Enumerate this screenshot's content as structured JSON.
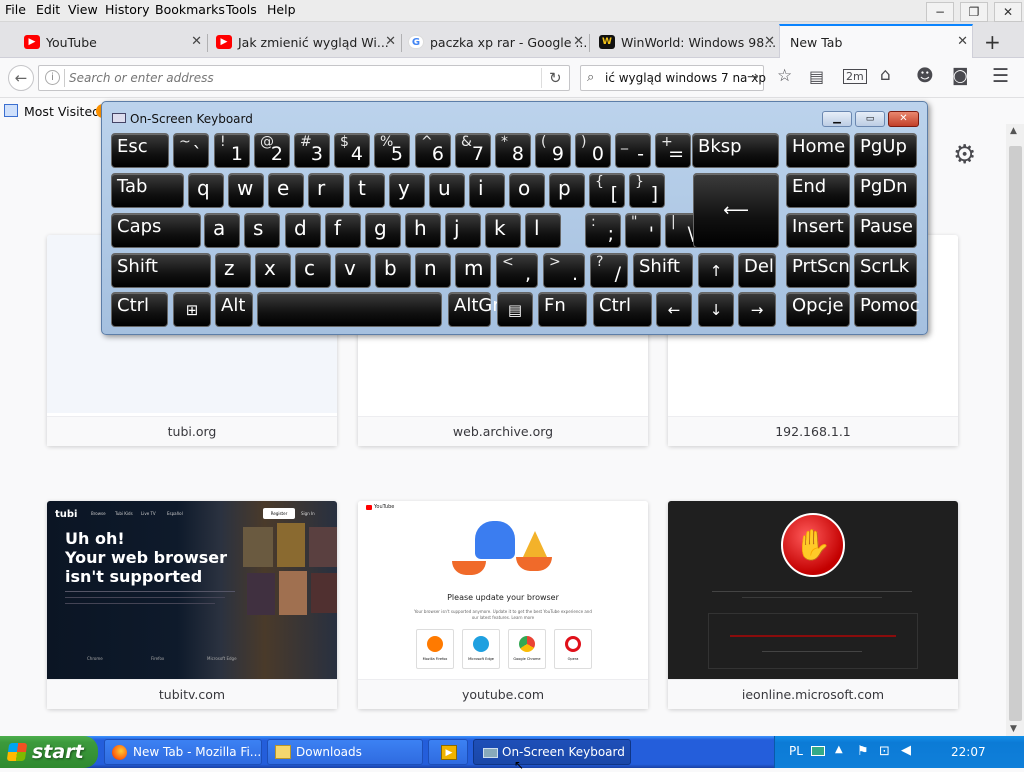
{
  "menu": {
    "items": [
      "File",
      "Edit",
      "View",
      "History",
      "Bookmarks",
      "Tools",
      "Help"
    ]
  },
  "window_controls": {
    "minimize": "−",
    "restore": "❐",
    "close": "✕"
  },
  "tabs": [
    {
      "label": "YouTube",
      "favicon": "youtube-icon",
      "color": "#ff0000"
    },
    {
      "label": "Jak zmienić wygląd Wi...",
      "favicon": "youtube-icon",
      "color": "#ff0000"
    },
    {
      "label": "paczka xp rar - Google ...",
      "favicon": "google-icon",
      "color": "#4285f4"
    },
    {
      "label": "WinWorld: Windows 98...",
      "favicon": "winworld-icon",
      "color": "#1a1a1a"
    },
    {
      "label": "New Tab",
      "favicon": "",
      "color": "",
      "active": true
    }
  ],
  "new_tab_label": "+",
  "urlbar": {
    "placeholder": "Search or enter address"
  },
  "searchbar": {
    "value": "ić wygląd windows 7 na xp"
  },
  "bookmarks": {
    "most_visited": "Most Visited"
  },
  "osk": {
    "title": "On-Screen Keyboard",
    "row1": [
      {
        "main": "Esc"
      },
      {
        "up": "~",
        "dn": "`"
      },
      {
        "up": "!",
        "dn": "1"
      },
      {
        "up": "@",
        "dn": "2"
      },
      {
        "up": "#",
        "dn": "3"
      },
      {
        "up": "$",
        "dn": "4"
      },
      {
        "up": "%",
        "dn": "5"
      },
      {
        "up": "^",
        "dn": "6"
      },
      {
        "up": "&",
        "dn": "7"
      },
      {
        "up": "*",
        "dn": "8"
      },
      {
        "up": "(",
        "dn": "9"
      },
      {
        "up": ")",
        "dn": "0"
      },
      {
        "up": "_",
        "dn": "-"
      },
      {
        "up": "+",
        "dn": "="
      },
      {
        "main": "Bksp"
      },
      {
        "main": "Home"
      },
      {
        "main": "PgUp"
      }
    ],
    "row2": [
      {
        "main": "Tab"
      },
      {
        "main": "q"
      },
      {
        "main": "w"
      },
      {
        "main": "e"
      },
      {
        "main": "r"
      },
      {
        "main": "t"
      },
      {
        "main": "y"
      },
      {
        "main": "u"
      },
      {
        "main": "i"
      },
      {
        "main": "o"
      },
      {
        "main": "p"
      },
      {
        "up": "{",
        "dn": "["
      },
      {
        "up": "}",
        "dn": "]"
      },
      {
        "main": ""
      },
      {
        "main": "End"
      },
      {
        "main": "PgDn"
      }
    ],
    "row3": [
      {
        "main": "Caps"
      },
      {
        "main": "a"
      },
      {
        "main": "s"
      },
      {
        "main": "d"
      },
      {
        "main": "f"
      },
      {
        "main": "g"
      },
      {
        "main": "h"
      },
      {
        "main": "j"
      },
      {
        "main": "k"
      },
      {
        "main": "l"
      },
      {
        "up": ":",
        "dn": ";"
      },
      {
        "up": "\"",
        "dn": "'"
      },
      {
        "up": "|",
        "dn": "\\"
      },
      {
        "main": "Insert"
      },
      {
        "main": "Pause"
      }
    ],
    "row4": [
      {
        "main": "Shift"
      },
      {
        "main": "z"
      },
      {
        "main": "x"
      },
      {
        "main": "c"
      },
      {
        "main": "v"
      },
      {
        "main": "b"
      },
      {
        "main": "n"
      },
      {
        "main": "m"
      },
      {
        "up": "<",
        "dn": ","
      },
      {
        "up": ">",
        "dn": "."
      },
      {
        "up": "?",
        "dn": "/"
      },
      {
        "main": "Shift"
      },
      {
        "main": "↑"
      },
      {
        "main": "Del"
      },
      {
        "main": "PrtScn"
      },
      {
        "main": "ScrLk"
      }
    ],
    "row5": [
      {
        "main": "Ctrl"
      },
      {
        "main": "⊞"
      },
      {
        "main": "Alt"
      },
      {
        "main": ""
      },
      {
        "main": "AltGr"
      },
      {
        "main": "▤"
      },
      {
        "main": "Fn"
      },
      {
        "main": "Ctrl"
      },
      {
        "main": "←"
      },
      {
        "main": "↓"
      },
      {
        "main": "→"
      },
      {
        "main": "Opcje"
      },
      {
        "main": "Pomoc"
      }
    ]
  },
  "tiles": [
    {
      "label": "tubi.org"
    },
    {
      "label": "web.archive.org"
    },
    {
      "label": "192.168.1.1"
    },
    {
      "label": "tubitv.com",
      "thumb": {
        "logo": "tubi",
        "nav": [
          "Browse",
          "Tubi Kids",
          "Live TV",
          "Español"
        ],
        "register": "Register",
        "sign_in": "Sign In",
        "headline": [
          "Uh oh!",
          "Your web browser",
          "isn't supported"
        ],
        "links": [
          "Chrome",
          "Firefox",
          "Microsoft Edge"
        ]
      }
    },
    {
      "label": "youtube.com",
      "thumb": {
        "logo": "YouTube",
        "heading": "Please update your browser",
        "body": "Your browser isn't supported anymore. Update it to get the best YouTube experience and our latest features. Learn more",
        "browsers": [
          "Mozilla Firefox",
          "Microsoft Edge",
          "Google Chrome",
          "Opera"
        ]
      }
    },
    {
      "label": "ieonline.microsoft.com"
    }
  ],
  "taskbar": {
    "start": "start",
    "buttons": [
      "New Tab - Mozilla Fi...",
      "Downloads",
      "",
      "On-Screen Keyboard"
    ],
    "lang": "PL",
    "clock": "22:07"
  }
}
